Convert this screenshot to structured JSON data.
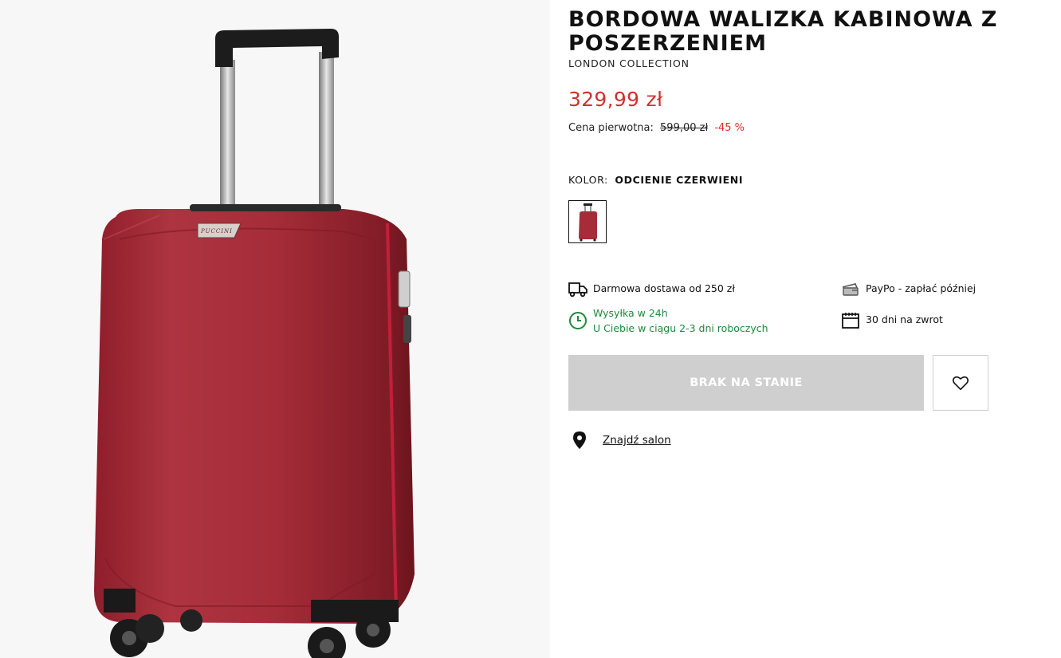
{
  "product": {
    "title": "BORDOWA WALIZKA KABINOWA Z POSZERZENIEM",
    "brand": "LONDON COLLECTION",
    "price": "329,99 zł",
    "original_price_label": "Cena pierwotna:",
    "original_price": "599,00 zł",
    "discount": "-45 %",
    "image_logo_text": "PUCCINI"
  },
  "color": {
    "label": "KOLOR:",
    "value": "ODCIENIE CZERWIENI"
  },
  "features": {
    "delivery": "Darmowa dostawa od 250 zł",
    "paypo": "PayPo - zapłać później",
    "shipping_line1": "Wysyłka w 24h",
    "shipping_line2": "U Ciebie w ciągu 2-3 dni roboczych",
    "returns": "30 dni na zwrot"
  },
  "actions": {
    "out_of_stock": "BRAK NA STANIE",
    "find_store": "Znajdź salon"
  },
  "colors": {
    "price_red": "#d0312d",
    "green": "#1d8a3c",
    "disabled_button": "#cfcfcf"
  },
  "icons": [
    "truck-icon",
    "wallet-icon",
    "clock-icon",
    "calendar-icon",
    "heart-icon",
    "location-pin-icon"
  ]
}
